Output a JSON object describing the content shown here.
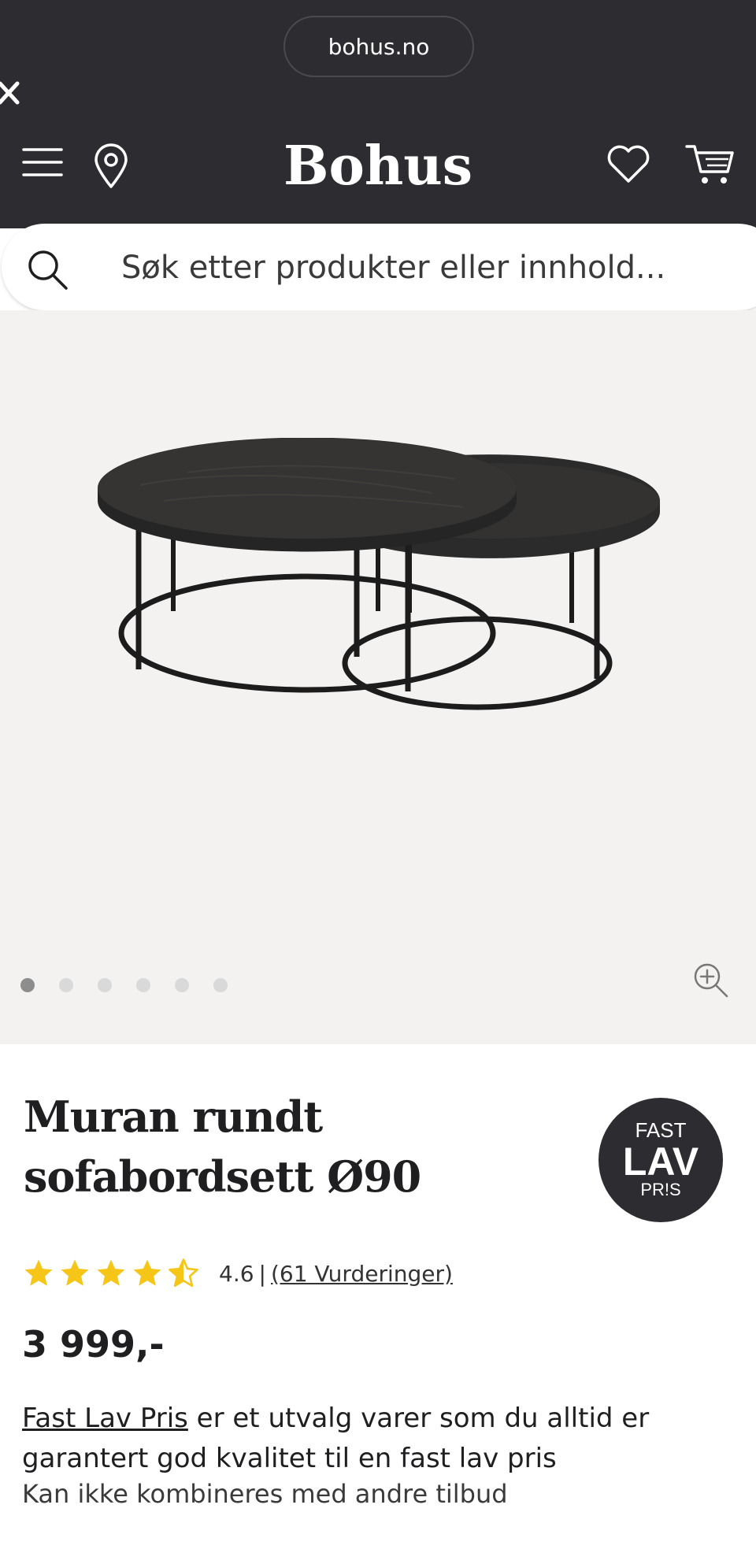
{
  "browser": {
    "url": "bohus.no"
  },
  "header": {
    "logo": "Bohus"
  },
  "search": {
    "placeholder": "Søk etter produkter eller innhold..."
  },
  "gallery": {
    "image_count": 6,
    "active_index": 0
  },
  "product": {
    "title_line1": "Muran rundt",
    "title_line2": "sofabordsett Ø90",
    "badge": {
      "line1": "FAST",
      "line2": "LAV",
      "line3": "PR!S"
    },
    "rating": {
      "value": 4.6,
      "value_text": "4.6",
      "separator": "|",
      "reviews_text": "(61 Vurderinger)"
    },
    "price": "3 999,-",
    "description_link": "Fast Lav Pris",
    "description_text": " er et utvalg varer som du alltid er garantert god kvalitet til en fast lav pris",
    "note": "Kan ikke kombineres med andre tilbud"
  },
  "colors": {
    "header_bg": "#2d2d31",
    "gallery_bg": "#f4f2f1",
    "star": "#f5c518"
  },
  "icons": [
    "close-icon",
    "menu-icon",
    "location-pin-icon",
    "heart-icon",
    "cart-icon",
    "search-icon",
    "zoom-icon",
    "star-icon"
  ]
}
